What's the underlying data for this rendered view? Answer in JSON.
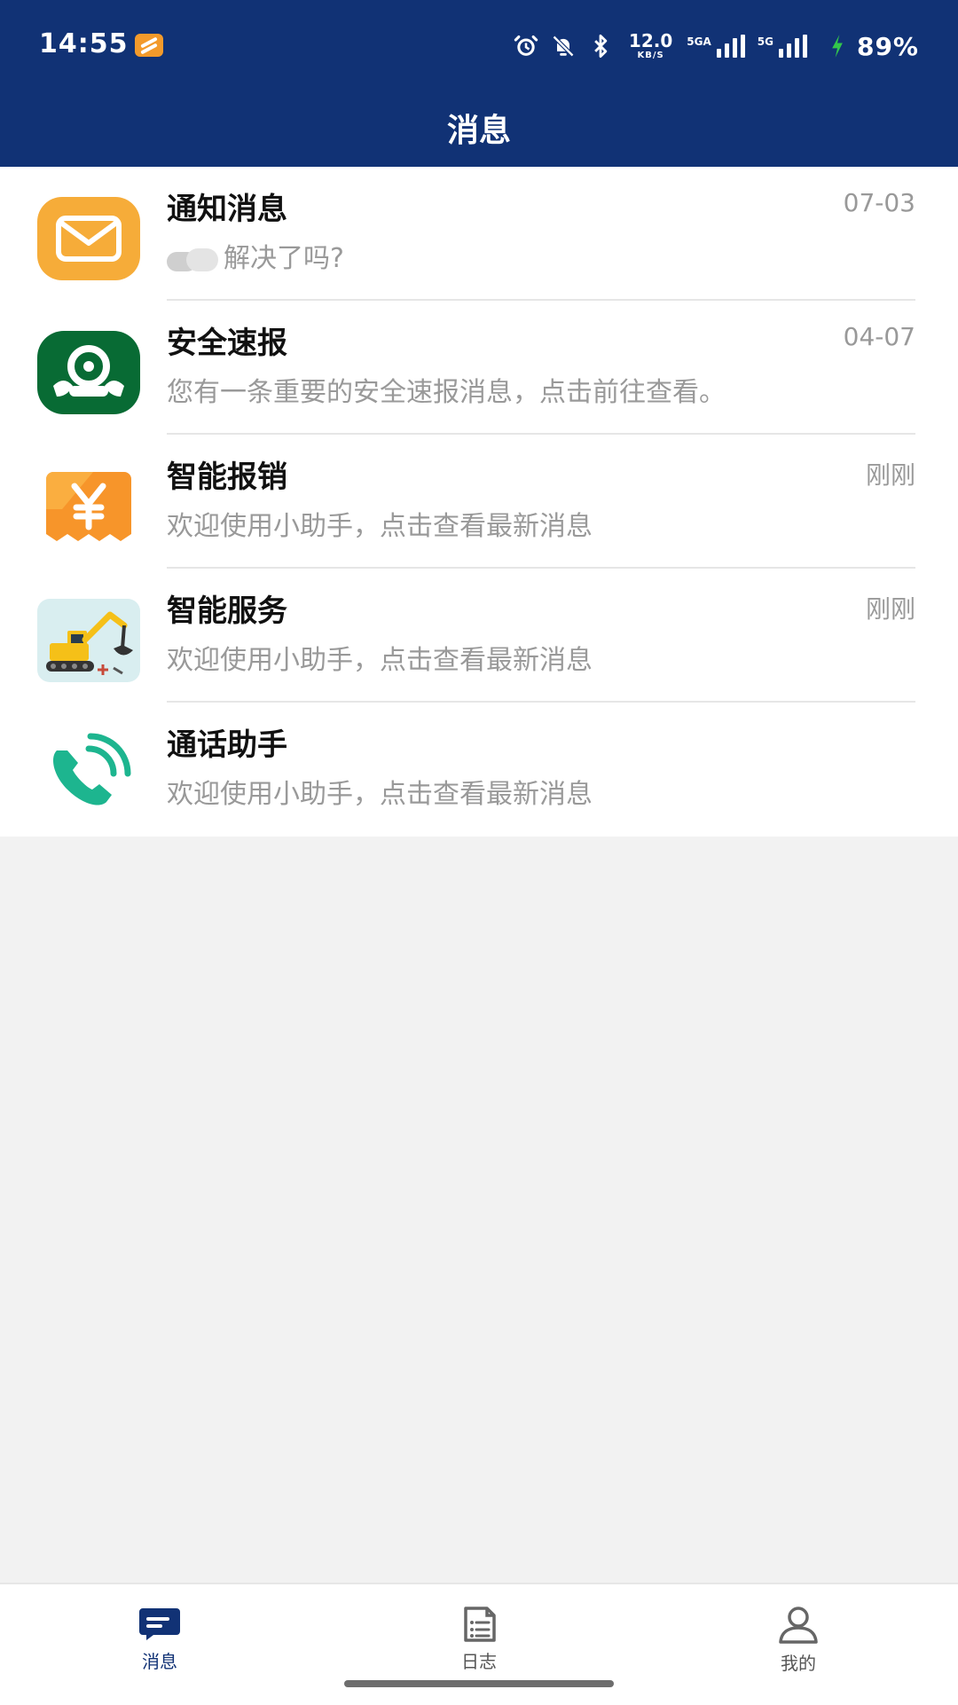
{
  "status_bar": {
    "time": "14:55",
    "speed_value": "12.0",
    "speed_unit": "KB/S",
    "network_1": "5GA",
    "network_2": "5G",
    "battery": "89%"
  },
  "header": {
    "title": "消息"
  },
  "list": {
    "items": [
      {
        "title": "通知消息",
        "preview": "解决了吗?",
        "time": "07-03",
        "icon": "envelope-icon"
      },
      {
        "title": "安全速报",
        "preview": "您有一条重要的安全速报消息，点击前往查看。",
        "time": "04-07",
        "icon": "safety-icon"
      },
      {
        "title": "智能报销",
        "preview": "欢迎使用小助手，点击查看最新消息",
        "time": "刚刚",
        "icon": "yen-receipt-icon"
      },
      {
        "title": "智能服务",
        "preview": "欢迎使用小助手，点击查看最新消息",
        "time": "刚刚",
        "icon": "excavator-icon"
      },
      {
        "title": "通话助手",
        "preview": "欢迎使用小助手，点击查看最新消息",
        "time": "",
        "icon": "phone-icon"
      }
    ]
  },
  "bottom_nav": {
    "items": [
      {
        "label": "消息",
        "icon": "chat-icon",
        "active": true
      },
      {
        "label": "日志",
        "icon": "document-icon",
        "active": false
      },
      {
        "label": "我的",
        "icon": "user-icon",
        "active": false
      }
    ]
  },
  "colors": {
    "primary": "#113275",
    "accent_orange": "#f6ac39",
    "safety_green": "#086b34",
    "phone_teal": "#1db58f"
  }
}
